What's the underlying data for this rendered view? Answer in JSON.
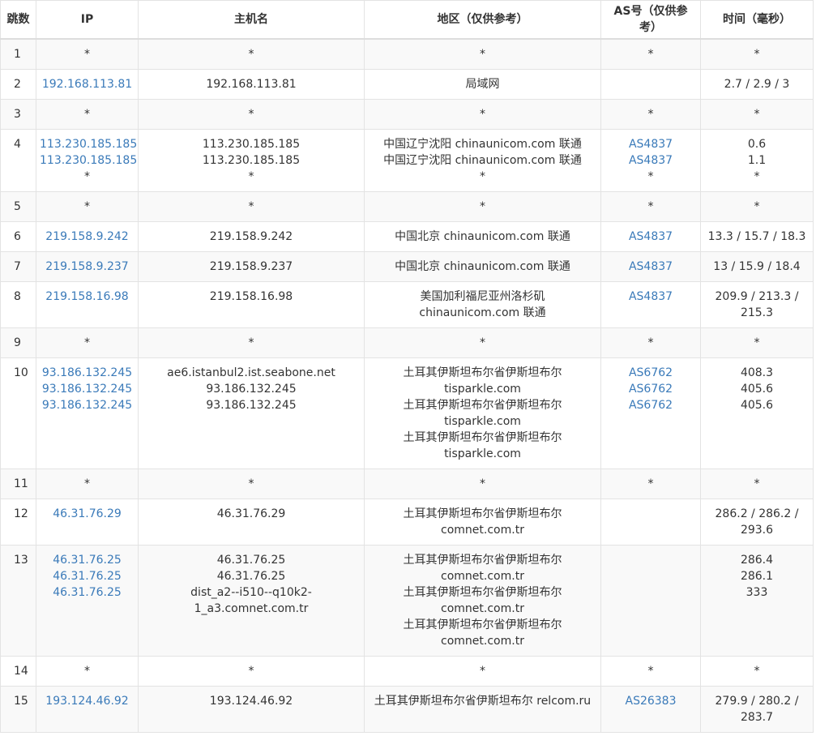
{
  "headers": {
    "hop": "跳数",
    "ip": "IP",
    "host": "主机名",
    "region": "地区（仅供参考）",
    "as": "AS号（仅供参考）",
    "time": "时间（毫秒）"
  },
  "rows": [
    {
      "hop": "1",
      "ip": [
        "*"
      ],
      "host": [
        "*"
      ],
      "region": [
        "*"
      ],
      "as": [
        "*"
      ],
      "time": [
        "*"
      ]
    },
    {
      "hop": "2",
      "ip": [
        "192.168.113.81"
      ],
      "host": [
        "192.168.113.81"
      ],
      "region": [
        "局域网"
      ],
      "as": [],
      "time": [
        "2.7 / 2.9 / 3"
      ]
    },
    {
      "hop": "3",
      "ip": [
        "*"
      ],
      "host": [
        "*"
      ],
      "region": [
        "*"
      ],
      "as": [
        "*"
      ],
      "time": [
        "*"
      ]
    },
    {
      "hop": "4",
      "ip": [
        "113.230.185.185",
        "113.230.185.185",
        "*"
      ],
      "host": [
        "113.230.185.185",
        "113.230.185.185",
        "*"
      ],
      "region": [
        "中国辽宁沈阳 chinaunicom.com 联通",
        "中国辽宁沈阳 chinaunicom.com 联通",
        "*"
      ],
      "as": [
        "AS4837",
        "AS4837",
        "*"
      ],
      "time": [
        "0.6",
        "1.1",
        "*"
      ]
    },
    {
      "hop": "5",
      "ip": [
        "*"
      ],
      "host": [
        "*"
      ],
      "region": [
        "*"
      ],
      "as": [
        "*"
      ],
      "time": [
        "*"
      ]
    },
    {
      "hop": "6",
      "ip": [
        "219.158.9.242"
      ],
      "host": [
        "219.158.9.242"
      ],
      "region": [
        "中国北京 chinaunicom.com 联通"
      ],
      "as": [
        "AS4837"
      ],
      "time": [
        "13.3 / 15.7 / 18.3"
      ]
    },
    {
      "hop": "7",
      "ip": [
        "219.158.9.237"
      ],
      "host": [
        "219.158.9.237"
      ],
      "region": [
        "中国北京 chinaunicom.com 联通"
      ],
      "as": [
        "AS4837"
      ],
      "time": [
        "13 / 15.9 / 18.4"
      ]
    },
    {
      "hop": "8",
      "ip": [
        "219.158.16.98"
      ],
      "host": [
        "219.158.16.98"
      ],
      "region": [
        "美国加利福尼亚州洛杉矶",
        "chinaunicom.com 联通"
      ],
      "as": [
        "AS4837"
      ],
      "time": [
        "209.9 / 213.3 /",
        "215.3"
      ]
    },
    {
      "hop": "9",
      "ip": [
        "*"
      ],
      "host": [
        "*"
      ],
      "region": [
        "*"
      ],
      "as": [
        "*"
      ],
      "time": [
        "*"
      ]
    },
    {
      "hop": "10",
      "ip": [
        "93.186.132.245",
        "93.186.132.245",
        "93.186.132.245"
      ],
      "host": [
        "ae6.istanbul2.ist.seabone.net",
        "93.186.132.245",
        "93.186.132.245"
      ],
      "region": [
        "土耳其伊斯坦布尔省伊斯坦布尔",
        "tisparkle.com",
        "土耳其伊斯坦布尔省伊斯坦布尔",
        "tisparkle.com",
        "土耳其伊斯坦布尔省伊斯坦布尔",
        "tisparkle.com"
      ],
      "as": [
        "AS6762",
        "AS6762",
        "AS6762"
      ],
      "time": [
        "408.3",
        "405.6",
        "405.6"
      ]
    },
    {
      "hop": "11",
      "ip": [
        "*"
      ],
      "host": [
        "*"
      ],
      "region": [
        "*"
      ],
      "as": [
        "*"
      ],
      "time": [
        "*"
      ]
    },
    {
      "hop": "12",
      "ip": [
        "46.31.76.29"
      ],
      "host": [
        "46.31.76.29"
      ],
      "region": [
        "土耳其伊斯坦布尔省伊斯坦布尔",
        "comnet.com.tr"
      ],
      "as": [],
      "time": [
        "286.2 / 286.2 /",
        "293.6"
      ]
    },
    {
      "hop": "13",
      "ip": [
        "46.31.76.25",
        "46.31.76.25",
        "46.31.76.25"
      ],
      "host": [
        "46.31.76.25",
        "46.31.76.25",
        "dist_a2--i510--q10k2-",
        "1_a3.comnet.com.tr"
      ],
      "region": [
        "土耳其伊斯坦布尔省伊斯坦布尔",
        "comnet.com.tr",
        "土耳其伊斯坦布尔省伊斯坦布尔",
        "comnet.com.tr",
        "土耳其伊斯坦布尔省伊斯坦布尔",
        "comnet.com.tr"
      ],
      "as": [],
      "time": [
        "286.4",
        "286.1",
        "333"
      ]
    },
    {
      "hop": "14",
      "ip": [
        "*"
      ],
      "host": [
        "*"
      ],
      "region": [
        "*"
      ],
      "as": [
        "*"
      ],
      "time": [
        "*"
      ]
    },
    {
      "hop": "15",
      "ip": [
        "193.124.46.92"
      ],
      "host": [
        "193.124.46.92"
      ],
      "region": [
        "土耳其伊斯坦布尔省伊斯坦布尔 relcom.ru"
      ],
      "as": [
        "AS26383"
      ],
      "time": [
        "279.9 / 280.2 /",
        "283.7"
      ]
    }
  ],
  "colors": {
    "link": "#3a7ab9",
    "stripe": "#f9f9f9",
    "border": "#e3e3e3",
    "text": "#333333"
  }
}
